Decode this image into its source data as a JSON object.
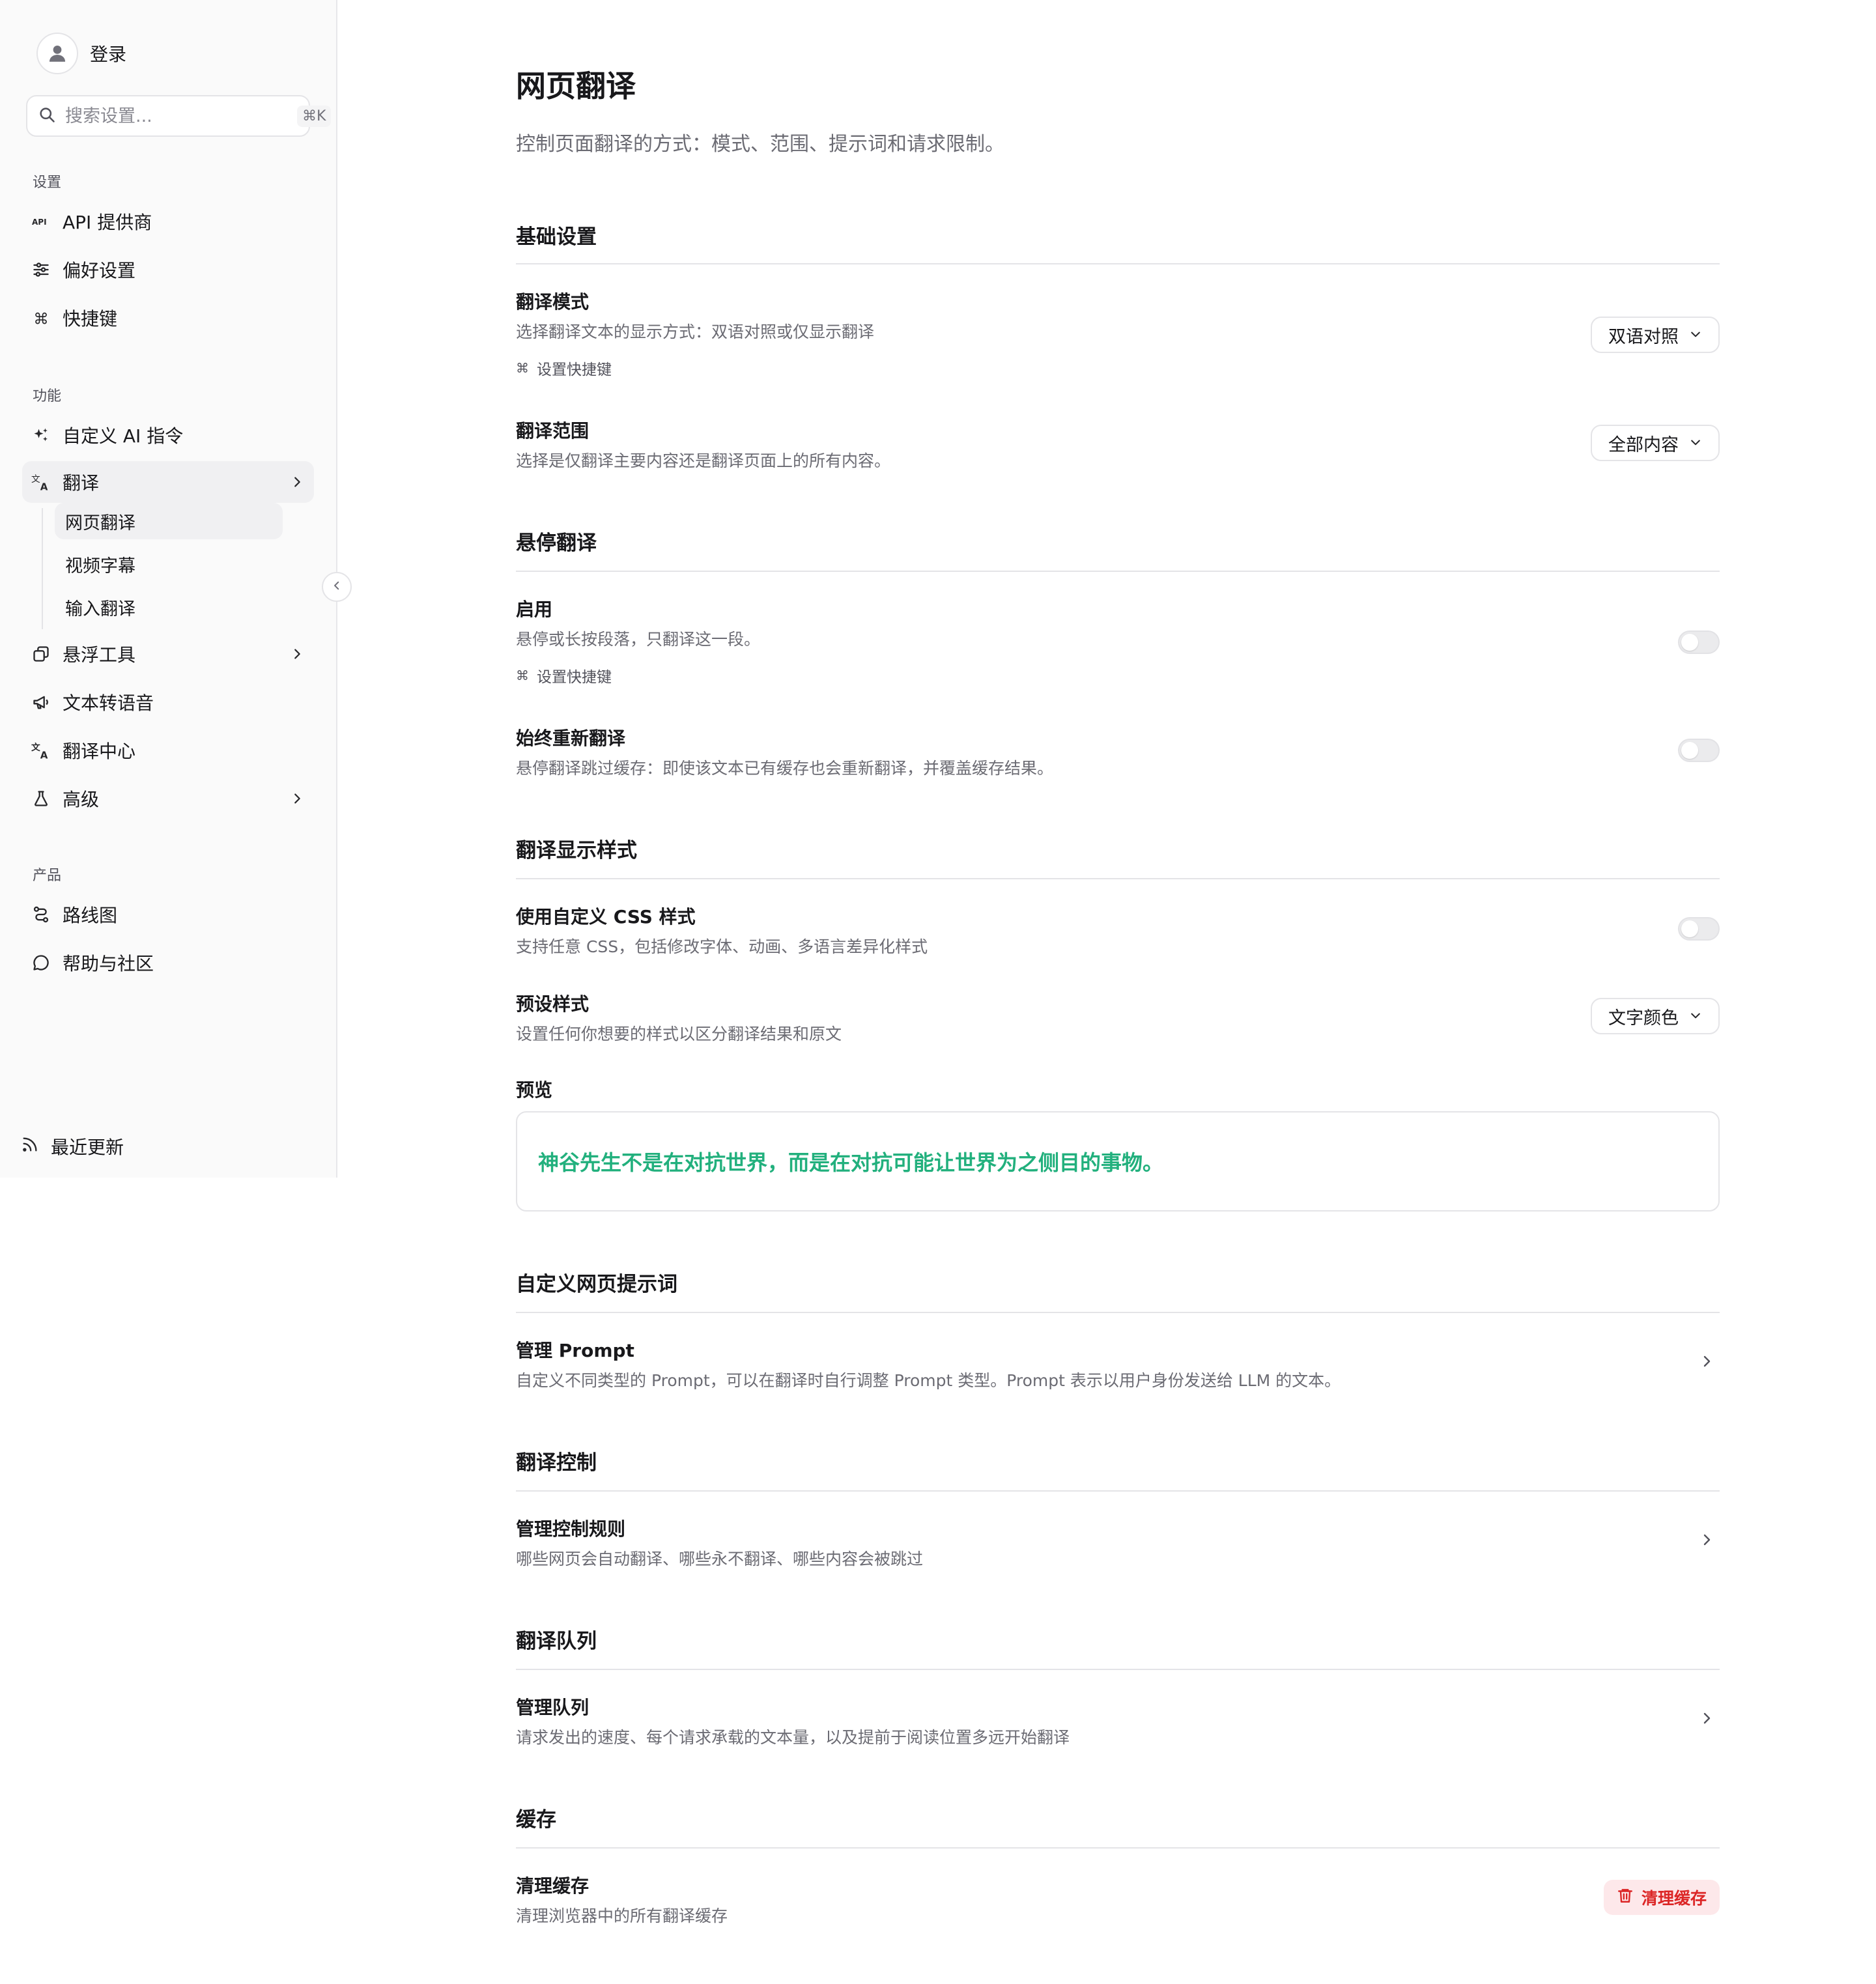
{
  "sidebar": {
    "login_label": "登录",
    "search_placeholder": "搜索设置...",
    "search_shortcut": "⌘K",
    "groups": {
      "settings": "设置",
      "features": "功能",
      "product": "产品"
    },
    "items": {
      "api_provider": "API 提供商",
      "preferences": "偏好设置",
      "shortcuts": "快捷键",
      "custom_ai": "自定义 AI 指令",
      "translate": "翻译",
      "floating_tools": "悬浮工具",
      "tts": "文本转语音",
      "translation_hub": "翻译中心",
      "advanced": "高级",
      "roadmap": "路线图",
      "help": "帮助与社区"
    },
    "sub_items": {
      "webpage": "网页翻译",
      "video_subtitles": "视频字幕",
      "input_translation": "输入翻译"
    },
    "recent_updates": "最近更新"
  },
  "main": {
    "title": "网页翻译",
    "description": "控制页面翻译的方式：模式、范围、提示词和请求限制。",
    "basic": {
      "title": "基础设置",
      "mode_title": "翻译模式",
      "mode_desc": "选择翻译文本的显示方式：双语对照或仅显示翻译",
      "mode_shortcut": "设置快捷键",
      "mode_value": "双语对照",
      "range_title": "翻译范围",
      "range_desc": "选择是仅翻译主要内容还是翻译页面上的所有内容。",
      "range_value": "全部内容"
    },
    "hover": {
      "title": "悬停翻译",
      "enable_title": "启用",
      "enable_desc": "悬停或长按段落，只翻译这一段。",
      "enable_shortcut": "设置快捷键",
      "enable_on": false,
      "retranslate_title": "始终重新翻译",
      "retranslate_desc": "悬停翻译跳过缓存：即使该文本已有缓存也会重新翻译，并覆盖缓存结果。",
      "retranslate_on": false
    },
    "display": {
      "title": "翻译显示样式",
      "css_title": "使用自定义 CSS 样式",
      "css_desc": "支持任意 CSS，包括修改字体、动画、多语言差异化样式",
      "css_on": false,
      "preset_title": "预设样式",
      "preset_desc": "设置任何你想要的样式以区分翻译结果和原文",
      "preset_value": "文字颜色",
      "preview_label": "预览",
      "preview_text": "神谷先生不是在对抗世界，而是在对抗可能让世界为之侧目的事物。",
      "preview_color": "#22b07d"
    },
    "prompt": {
      "title": "自定义网页提示词",
      "manage_title": "管理 Prompt",
      "manage_desc": "自定义不同类型的 Prompt，可以在翻译时自行调整 Prompt 类型。Prompt 表示以用户身份发送给 LLM 的文本。"
    },
    "control": {
      "title": "翻译控制",
      "manage_title": "管理控制规则",
      "manage_desc": "哪些网页会自动翻译、哪些永不翻译、哪些内容会被跳过"
    },
    "queue": {
      "title": "翻译队列",
      "manage_title": "管理队列",
      "manage_desc": "请求发出的速度、每个请求承载的文本量，以及提前于阅读位置多远开始翻译"
    },
    "cache": {
      "title": "缓存",
      "clear_title": "清理缓存",
      "clear_desc": "清理浏览器中的所有翻译缓存",
      "clear_button": "清理缓存"
    }
  },
  "colors": {
    "accent_green": "#22b07d",
    "danger": "#dc2626",
    "danger_bg": "#fde8ea"
  }
}
